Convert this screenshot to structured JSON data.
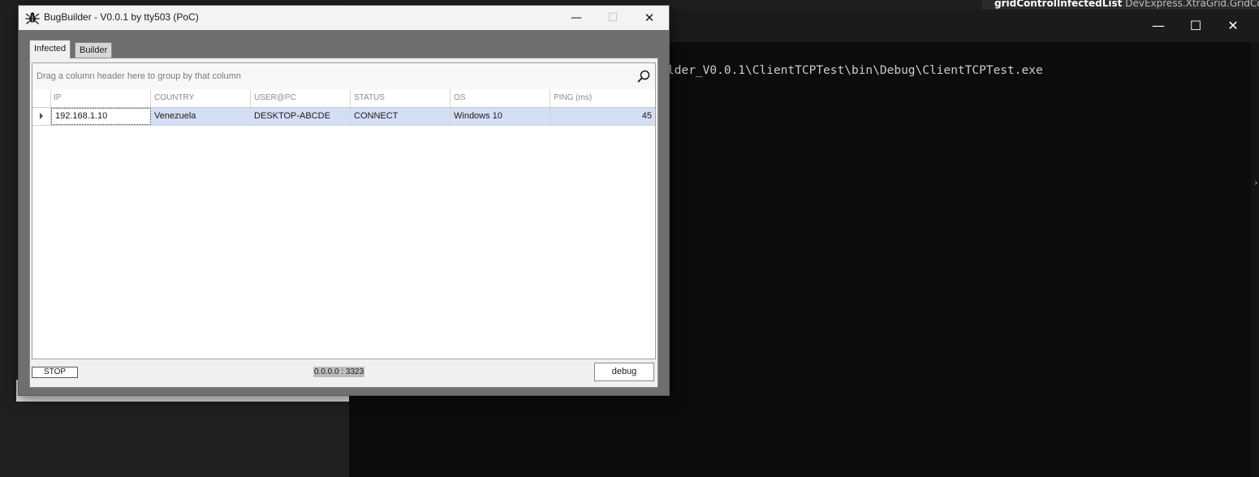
{
  "background": {
    "properties_header": {
      "name": "gridControlInfectedList",
      "type": "DevExpress.XtraGrid.GridControl"
    },
    "console": {
      "path_text": "lder_V0.0.1\\ClientTCPTest\\bin\\Debug\\ClientTCPTest.exe",
      "controls": {
        "minimize": "—",
        "maximize": "☐",
        "close": "✕"
      },
      "edge_glyph": "›"
    }
  },
  "window": {
    "title": "BugBuilder - V0.0.1 by tty503 (PoC)",
    "icon": "bug-icon",
    "controls": {
      "minimize": "—",
      "maximize": "☐",
      "close": "✕"
    }
  },
  "tabs": [
    {
      "label": "Infected",
      "active": true
    },
    {
      "label": "Builder",
      "active": false
    }
  ],
  "grid": {
    "group_panel_text": "Drag a column header here to group by that column",
    "search_icon": "search-icon",
    "columns": [
      "IP",
      "COUNTRY",
      "USER@PC",
      "STATUS",
      "OS",
      "PING (ms)"
    ],
    "rows": [
      {
        "ip": "192.168.1.10",
        "country": "Venezuela",
        "user_pc": "DESKTOP-ABCDE",
        "status": "CONNECT",
        "os": "Windows 10",
        "ping": "45"
      }
    ],
    "selected_row_color": "#d4dff5"
  },
  "footer": {
    "stop_label": "STOP",
    "listen_address": "0.0.0.0 : 3323",
    "debug_label": "debug"
  }
}
